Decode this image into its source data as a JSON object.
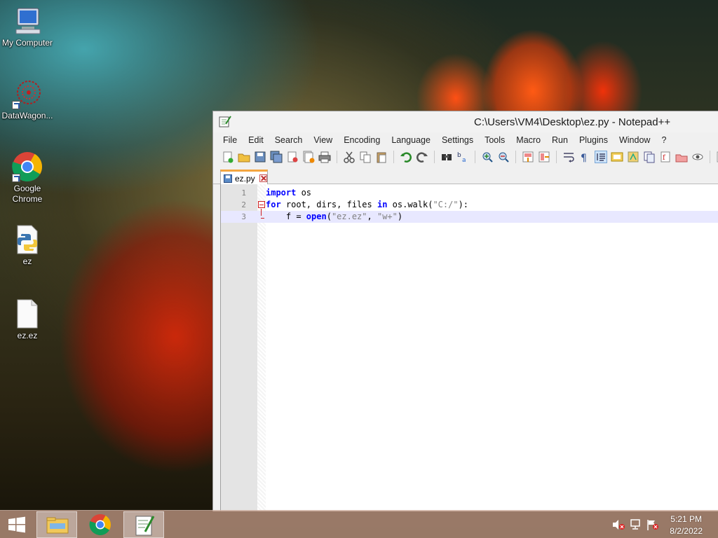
{
  "desktop": {
    "icons": [
      {
        "label": "My Computer"
      },
      {
        "label": "DataWagon..."
      },
      {
        "label": "Google Chrome"
      },
      {
        "label": "ez"
      },
      {
        "label": "ez.ez"
      }
    ]
  },
  "window": {
    "title": "C:\\Users\\VM4\\Desktop\\ez.py - Notepad++",
    "menu": [
      "File",
      "Edit",
      "Search",
      "View",
      "Encoding",
      "Language",
      "Settings",
      "Tools",
      "Macro",
      "Run",
      "Plugins",
      "Window",
      "?"
    ],
    "tab": {
      "label": "ez.py"
    },
    "editor": {
      "lines": [
        {
          "num": "1",
          "tokens": [
            {
              "t": "import",
              "c": "kw"
            },
            {
              "t": " os",
              "c": ""
            }
          ]
        },
        {
          "num": "2",
          "tokens": [
            {
              "t": "for",
              "c": "kw"
            },
            {
              "t": " root, dirs, files ",
              "c": ""
            },
            {
              "t": "in",
              "c": "kw"
            },
            {
              "t": " os.walk(",
              "c": ""
            },
            {
              "t": "\"C:/\"",
              "c": "str"
            },
            {
              "t": "):",
              "c": ""
            }
          ]
        },
        {
          "num": "3",
          "tokens": [
            {
              "t": "    f = ",
              "c": ""
            },
            {
              "t": "open",
              "c": "kw"
            },
            {
              "t": "(",
              "c": ""
            },
            {
              "t": "\"ez.ez\"",
              "c": "str"
            },
            {
              "t": ", ",
              "c": ""
            },
            {
              "t": "\"w+\"",
              "c": "str"
            },
            {
              "t": ")",
              "c": ""
            }
          ]
        }
      ]
    }
  },
  "taskbar": {
    "clock": {
      "time": "5:21 PM",
      "date": "8/2/2022"
    }
  },
  "colors": {
    "accent_tab": "#f4a640",
    "keyword": "#0000ff",
    "string": "#808080",
    "current_line": "#e8e8ff"
  }
}
